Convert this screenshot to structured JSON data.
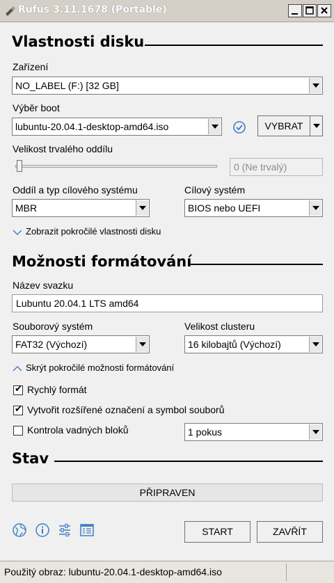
{
  "window": {
    "title": "Rufus 3.11.1678 (Portable)"
  },
  "disk": {
    "heading": "Vlastnosti disku",
    "device_label": "Zařízení",
    "device_value": "NO_LABEL (F:) [32 GB]",
    "boot_label": "Výběr boot",
    "boot_value": "lubuntu-20.04.1-desktop-amd64.iso",
    "select_button": "VYBRAT",
    "persistent_label": "Velikost trvalého oddílu",
    "persistent_value": "0 (Ne trvalý)",
    "persistent_level": 0,
    "partition_label": "Oddíl a typ cílového systému",
    "partition_value": "MBR",
    "target_label": "Cílový systém",
    "target_value": "BIOS nebo UEFI",
    "advanced_toggle": "Zobrazit pokročilé vlastnosti disku"
  },
  "format": {
    "heading": "Možnosti formátování",
    "volume_label": "Název svazku",
    "volume_value": "Lubuntu 20.04.1 LTS amd64",
    "fs_label": "Souborový systém",
    "fs_value": "FAT32 (Výchozí)",
    "cluster_label": "Velikost clusteru",
    "cluster_value": "16 kilobajtů (Výchozí)",
    "advanced_toggle": "Skrýt pokročilé možnosti formátování",
    "quick_format": "Rychlý formát",
    "extended_label": "Vytvořit rozšířené označení a symbol souborů",
    "bad_blocks": "Kontrola vadných bloků",
    "passes_value": "1 pokus"
  },
  "status": {
    "heading": "Stav",
    "text": "PŘIPRAVEN"
  },
  "actions": {
    "start": "START",
    "close": "ZAVŘÍT"
  },
  "statusbar": {
    "text": "Použitý obraz: lubuntu-20.04.1-desktop-amd64.iso"
  },
  "icons": [
    "globe-icon",
    "info-icon",
    "settings-sliders-icon",
    "log-icon"
  ],
  "colors": {
    "accent_blue": "#3c7fc4",
    "background": "#f0f0f0"
  }
}
